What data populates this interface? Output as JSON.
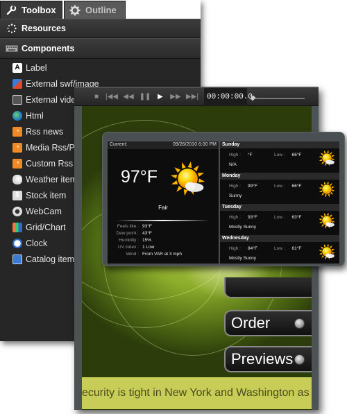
{
  "tabs": {
    "toolbox": "Toolbox",
    "outline": "Outline"
  },
  "sections": {
    "resources": "Resources",
    "components": "Components"
  },
  "components": [
    {
      "label": "Label",
      "icon": "label-icon"
    },
    {
      "label": "External swf/image",
      "icon": "image-icon"
    },
    {
      "label": "External video",
      "icon": "video-icon"
    },
    {
      "label": "Html",
      "icon": "globe-icon"
    },
    {
      "label": "Rss news",
      "icon": "rss-icon"
    },
    {
      "label": "Media Rss/Podcast",
      "icon": "rss-icon"
    },
    {
      "label": "Custom Rss item",
      "icon": "rss-icon"
    },
    {
      "label": "Weather item",
      "icon": "weather-icon"
    },
    {
      "label": "Stock item",
      "icon": "stock-icon"
    },
    {
      "label": "WebCam",
      "icon": "webcam-icon"
    },
    {
      "label": "Grid/Chart",
      "icon": "chart-icon"
    },
    {
      "label": "Clock",
      "icon": "clock-icon"
    },
    {
      "label": "Catalog item",
      "icon": "catalog-icon"
    }
  ],
  "player": {
    "time": "00:00:00.0"
  },
  "weather": {
    "current_label": "Current:",
    "datetime": "09/26/2010 6:00 PM",
    "temperature": "97°F",
    "condition": "Fair",
    "details": [
      {
        "key": "Feels like :",
        "value": "93°F"
      },
      {
        "key": "Dew point :",
        "value": "43°F"
      },
      {
        "key": "Humidity :",
        "value": "15%"
      },
      {
        "key": "UV index :",
        "value": "1 Low"
      },
      {
        "key": "Wind :",
        "value": "From VAR at 3 mph"
      }
    ],
    "forecast": [
      {
        "day": "Sunday",
        "high": "°F",
        "low": "66°F",
        "desc": "N/A",
        "icon": "partly-cloudy-icon"
      },
      {
        "day": "Monday",
        "high": "99°F",
        "low": "66°F",
        "desc": "Sunny",
        "icon": "sun-icon"
      },
      {
        "day": "Tuesday",
        "high": "93°F",
        "low": "63°F",
        "desc": "Mostly Sunny",
        "icon": "sun-cloud-icon"
      },
      {
        "day": "Wednesday",
        "high": "84°F",
        "low": "61°F",
        "desc": "Mostly Sunny",
        "icon": "sun-cloud-icon"
      }
    ],
    "high_label": "High :",
    "low_label": "Low :"
  },
  "menu": {
    "order": "Order",
    "previews": "Previews"
  },
  "ticker": {
    "text": "ecurity is tight in New York and Washington as"
  },
  "colors": {
    "ticker_bg": "#c7cd57",
    "panel_bg": "#262626"
  }
}
